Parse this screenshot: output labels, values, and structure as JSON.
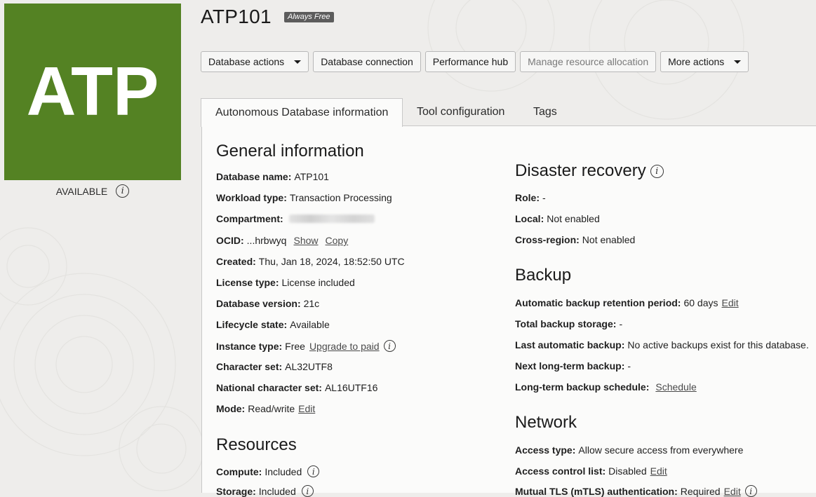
{
  "tile": {
    "text": "ATP",
    "color": "#548223"
  },
  "status": {
    "label": "AVAILABLE"
  },
  "header": {
    "title": "ATP101",
    "badge": "Always Free"
  },
  "actions": [
    {
      "label": "Database actions",
      "dropdown": true,
      "enabled": true
    },
    {
      "label": "Database connection",
      "dropdown": false,
      "enabled": true
    },
    {
      "label": "Performance hub",
      "dropdown": false,
      "enabled": true
    },
    {
      "label": "Manage resource allocation",
      "dropdown": false,
      "enabled": false
    },
    {
      "label": "More actions",
      "dropdown": true,
      "enabled": true
    }
  ],
  "tabs": [
    {
      "label": "Autonomous Database information",
      "active": true
    },
    {
      "label": "Tool configuration",
      "active": false
    },
    {
      "label": "Tags",
      "active": false
    }
  ],
  "general": {
    "title": "General information",
    "database_name": {
      "label": "Database name:",
      "value": "ATP101"
    },
    "workload_type": {
      "label": "Workload type:",
      "value": "Transaction Processing"
    },
    "compartment": {
      "label": "Compartment:",
      "value": ""
    },
    "ocid": {
      "label": "OCID:",
      "value": "...hrbwyq",
      "show": "Show",
      "copy": "Copy"
    },
    "created": {
      "label": "Created:",
      "value": "Thu, Jan 18, 2024, 18:52:50 UTC"
    },
    "license_type": {
      "label": "License type:",
      "value": "License included"
    },
    "database_version": {
      "label": "Database version:",
      "value": "21c"
    },
    "lifecycle_state": {
      "label": "Lifecycle state:",
      "value": "Available"
    },
    "instance_type": {
      "label": "Instance type:",
      "value": "Free",
      "link": "Upgrade to paid"
    },
    "character_set": {
      "label": "Character set:",
      "value": "AL32UTF8"
    },
    "national_character_set": {
      "label": "National character set:",
      "value": "AL16UTF16"
    },
    "mode": {
      "label": "Mode:",
      "value": "Read/write",
      "link": "Edit"
    }
  },
  "resources": {
    "title": "Resources",
    "compute": {
      "label": "Compute:",
      "value": "Included"
    },
    "storage": {
      "label": "Storage:",
      "value": "Included"
    }
  },
  "disaster_recovery": {
    "title": "Disaster recovery",
    "role": {
      "label": "Role:",
      "value": "-"
    },
    "local": {
      "label": "Local:",
      "value": "Not enabled"
    },
    "cross_region": {
      "label": "Cross-region:",
      "value": "Not enabled"
    }
  },
  "backup": {
    "title": "Backup",
    "retention": {
      "label": "Automatic backup retention period:",
      "value": "60 days",
      "link": "Edit"
    },
    "total_storage": {
      "label": "Total backup storage:",
      "value": "-"
    },
    "last_auto": {
      "label": "Last automatic backup:",
      "value": "No active backups exist for this database."
    },
    "next_long_term": {
      "label": "Next long-term backup:",
      "value": "-"
    },
    "long_term_schedule": {
      "label": "Long-term backup schedule:",
      "link": "Schedule"
    }
  },
  "network": {
    "title": "Network",
    "access_type": {
      "label": "Access type:",
      "value": "Allow secure access from everywhere"
    },
    "acl": {
      "label": "Access control list:",
      "value": "Disabled",
      "link": "Edit"
    },
    "mtls": {
      "label": "Mutual TLS (mTLS) authentication:",
      "value": "Required",
      "link": "Edit"
    }
  },
  "info_icon_glyph": "i"
}
